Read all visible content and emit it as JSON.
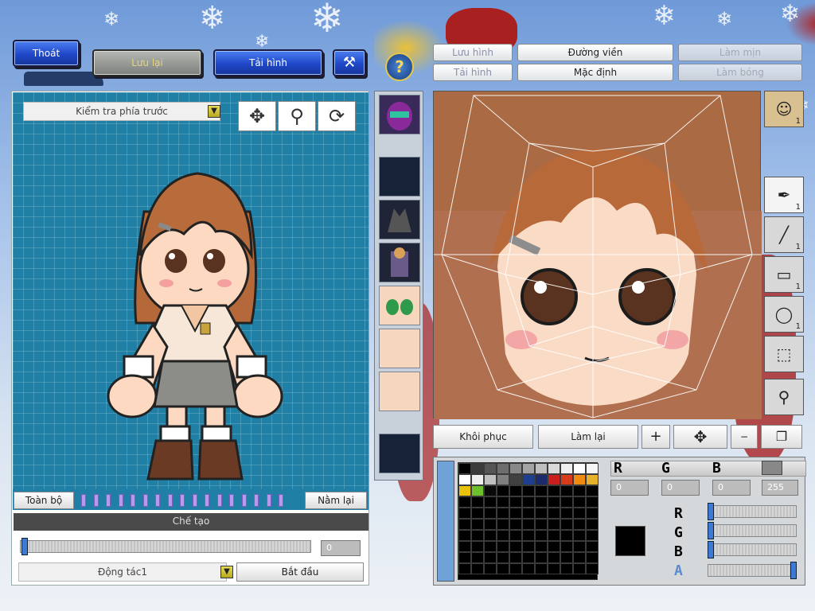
{
  "top_buttons": {
    "exit": "Thoát",
    "save": "Lưu lại",
    "reload": "Tải hình"
  },
  "editor_tabs": {
    "save_image": "Lưu hình",
    "load_image": "Tải hình",
    "outline": "Đường viền",
    "default": "Mặc định",
    "smooth": "Làm mịn",
    "shade": "Làm bóng"
  },
  "view_select": {
    "value": "Kiểm tra phía trước"
  },
  "left_panel": {
    "select_all": "Toàn bộ",
    "lie_down": "Nằm lại",
    "section_title": "Chế tạo",
    "frame_value": "0",
    "action_select": "Động tác1",
    "start_button": "Bắt đầu",
    "frame_ticks": 17
  },
  "face_editor": {
    "restore": "Khôi phục",
    "redo": "Làm lại"
  },
  "tool_counts": {
    "face": "1",
    "pen": "1",
    "line": "1",
    "rect": "1",
    "ellipse": "1"
  },
  "color": {
    "r_label": "R",
    "g_label": "G",
    "b_label": "B",
    "a_label": "A",
    "r_value": "0",
    "g_value": "0",
    "b_value": "0",
    "a_value": "255",
    "current_color": "#000000",
    "palette_row1": [
      "#000000",
      "#3b3b3b",
      "#555555",
      "#6e6e6e",
      "#888888",
      "#a3a3a3",
      "#bfbfbf",
      "#d9d9d9",
      "#efefef",
      "#ffffff",
      "#f6f6f6"
    ],
    "palette_row2": [
      "#ffffff",
      "#f0f0f0",
      "#c0c0c0",
      "#808080",
      "#404040",
      "#1e3e8e",
      "#1a2a6a",
      "#c81e1e",
      "#d83a1a",
      "#f08a10",
      "#e7b22b"
    ],
    "palette_row3": [
      "#e8c20a",
      "#6cc02a",
      "#0a0a0a"
    ]
  }
}
